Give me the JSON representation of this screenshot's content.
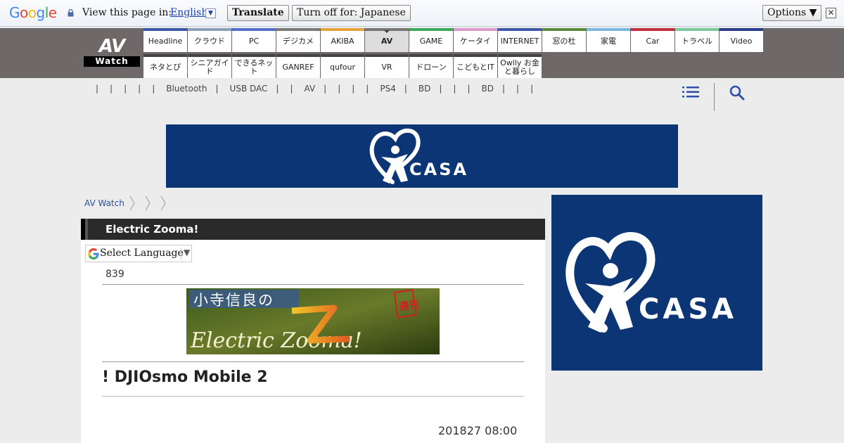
{
  "translate_bar": {
    "logo": "Google",
    "view_text": "View this page in:",
    "language": "English",
    "translate_label": "Translate",
    "turn_off_label": "Turn off for: Japanese",
    "options_label": "Options ▼",
    "close_glyph": "✕"
  },
  "logo": {
    "top": "AV",
    "bottom": "Watch"
  },
  "nav": {
    "row1": [
      "Headline",
      "クラウド",
      "PC",
      "デジカメ",
      "AKIBA",
      "AV",
      "GAME",
      "ケータイ",
      "INTERNET",
      "窓の杜",
      "家電",
      "Car",
      "トラベル",
      "Video"
    ],
    "row1_colors": [
      "#3c5aa8",
      "#8aa0b8",
      "#5570c8",
      "#7a7a7a",
      "#e6a23c",
      "#777777",
      "#3ca85a",
      "#d89ac8",
      "#3c5aa8",
      "#5a8a3c",
      "#7ab8e0",
      "#c0303c",
      "#7ac8a0",
      "#2a3c8a"
    ],
    "row2": [
      "ネタとぴ",
      "シニアガイド",
      "できるネット",
      "GANREF",
      "qufour",
      "VR",
      "ドローン",
      "こどもとIT",
      "Owlly お金と暮らし"
    ],
    "active": "AV"
  },
  "subnav": {
    "items": [
      "",
      "",
      "",
      "",
      "Bluetooth",
      "USB DAC",
      "",
      "AV",
      "",
      "",
      "",
      "PS4",
      "BD",
      "",
      "",
      "BD",
      "",
      "",
      ""
    ]
  },
  "ads": {
    "brand": "CASA"
  },
  "breadcrumb": {
    "home": "AV Watch"
  },
  "article": {
    "section": "Electric Zooma!",
    "select_language": "Select Language",
    "issue_no": "839",
    "banner_jp": "小寺信良の",
    "banner_en": "Electric Zooma!",
    "banner_stamp": "週刊",
    "title": "! DJIOsmo Mobile 2",
    "date": "201827 08:00"
  }
}
